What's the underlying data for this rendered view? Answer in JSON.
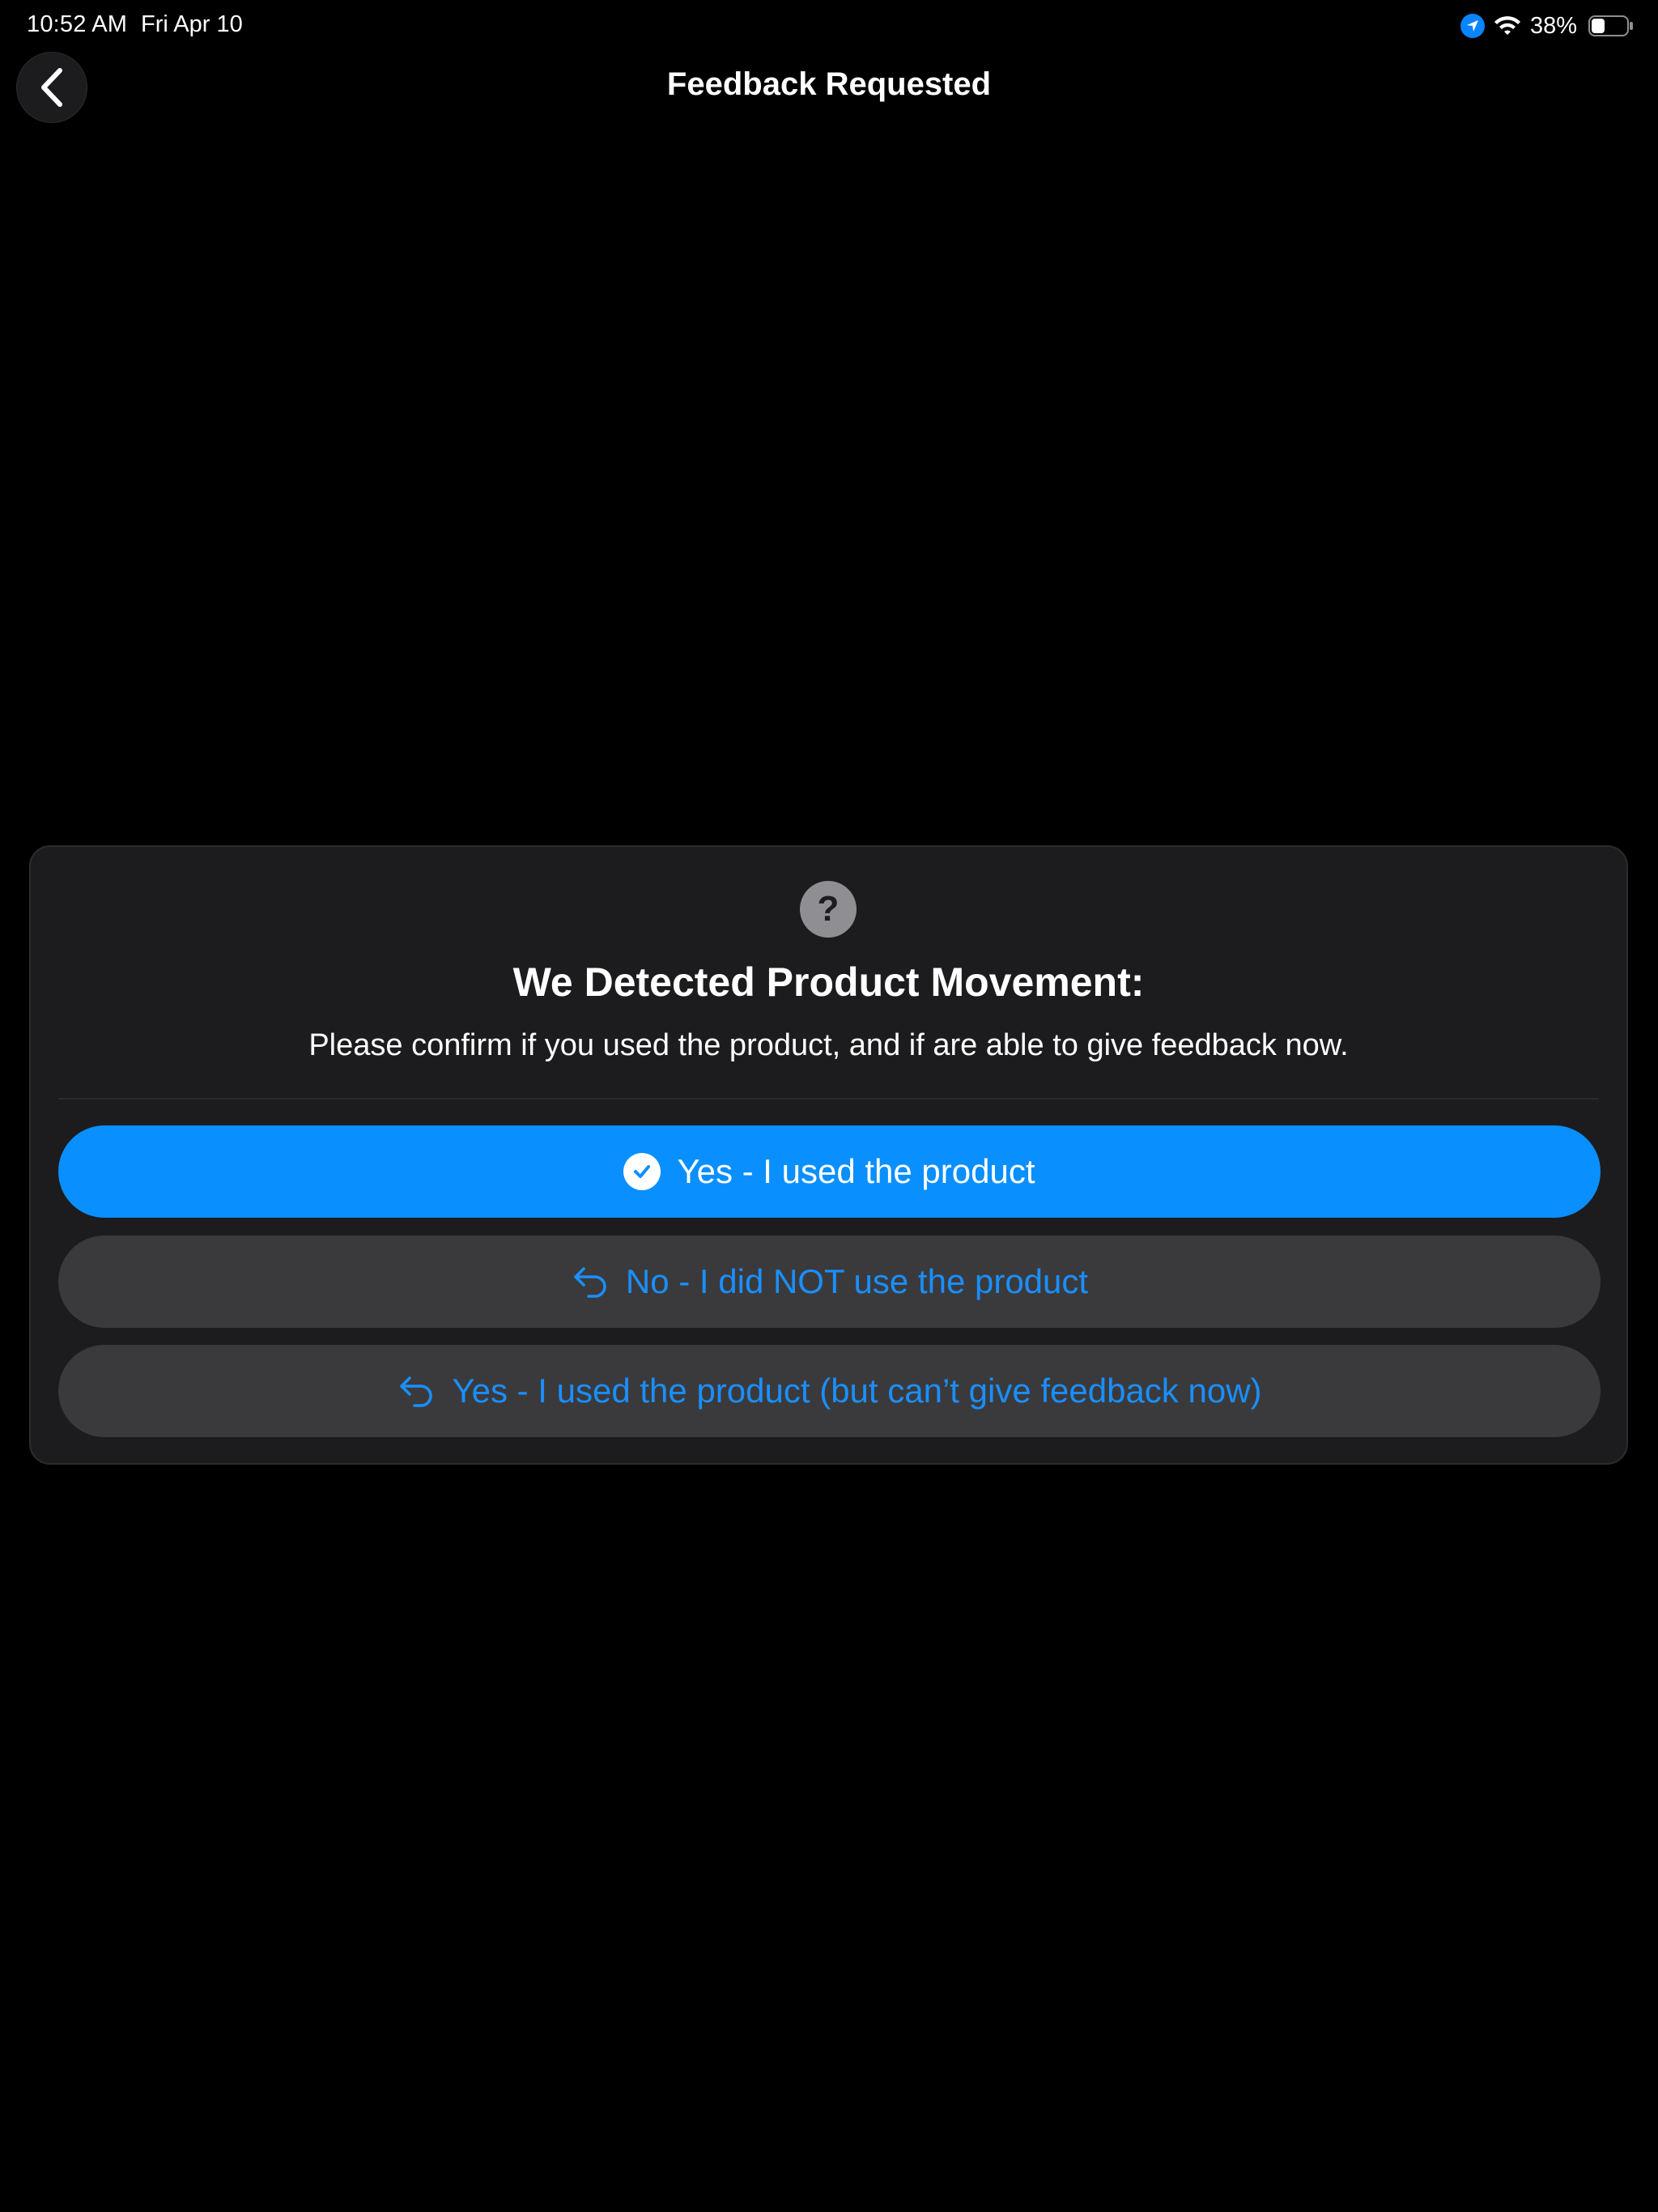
{
  "status_bar": {
    "time": "10:52 AM",
    "date": "Fri Apr 10",
    "battery_percent": "38%",
    "battery_level": 0.38,
    "icons": [
      "location-arrow-icon",
      "wifi-icon",
      "battery-icon"
    ]
  },
  "nav": {
    "title": "Feedback Requested",
    "back_icon": "chevron-left-icon"
  },
  "prompt": {
    "icon": "question-mark-icon",
    "icon_glyph": "?",
    "title": "We Detected Product Movement:",
    "subtitle": "Please confirm if you used the product, and if are able to give feedback now."
  },
  "options": [
    {
      "label": "Yes - I used the product",
      "icon": "checkmark-circle-icon",
      "style": "primary"
    },
    {
      "label": "No - I did NOT use the product",
      "icon": "reply-arrow-icon",
      "style": "secondary"
    },
    {
      "label": "Yes - I used the product (but can’t give feedback now)",
      "icon": "reply-arrow-icon",
      "style": "secondary"
    }
  ],
  "colors": {
    "background": "#000000",
    "card": "#1c1c1e",
    "primary_button": "#0a8fff",
    "secondary_button": "#3a3a3c",
    "secondary_text": "#1a8fff",
    "help_icon": "#8e8e93"
  }
}
